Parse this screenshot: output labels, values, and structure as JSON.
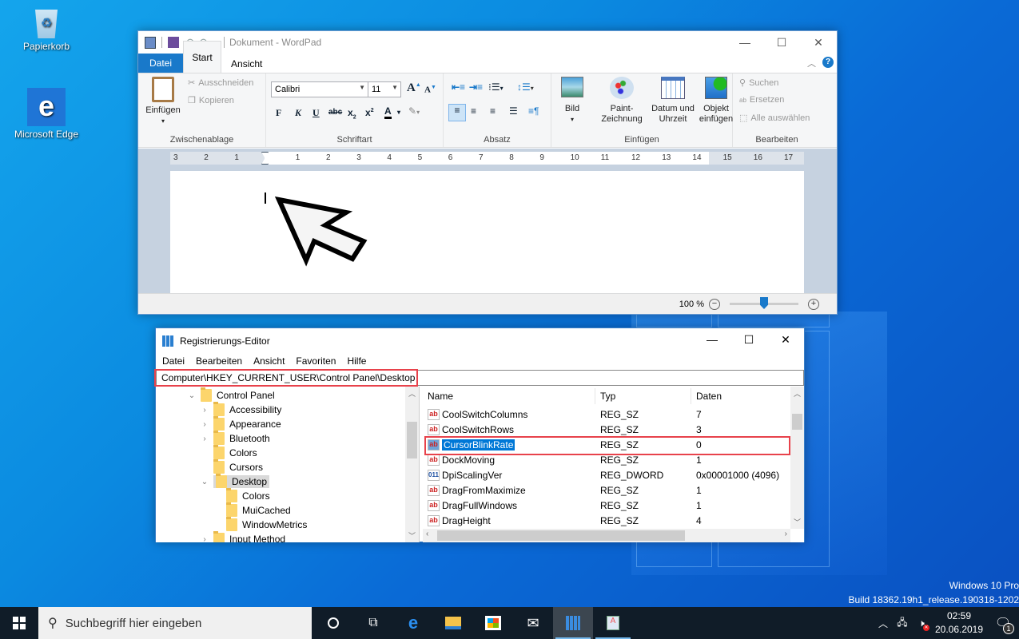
{
  "desktop": {
    "icons": [
      {
        "label": "Papierkorb",
        "icon": "recycle-bin-icon"
      },
      {
        "label": "Microsoft Edge",
        "icon": "edge-icon"
      }
    ],
    "watermark": {
      "line1": "Windows 10 Pro",
      "line2": "Build 18362.19h1_release.190318-1202"
    }
  },
  "wordpad": {
    "title": "Dokument - WordPad",
    "tabs": [
      "Datei",
      "Start",
      "Ansicht"
    ],
    "active_tab": "Start",
    "clipboard": {
      "paste": "Einfügen",
      "cut": "Ausschneiden",
      "copy": "Kopieren",
      "label": "Zwischenablage"
    },
    "font": {
      "family": "Calibri",
      "size": "11",
      "label": "Schriftart",
      "bold": "F",
      "italic": "K",
      "underline": "U",
      "strike": "abc"
    },
    "paragraph": {
      "label": "Absatz"
    },
    "insert": {
      "picture": "Bild",
      "paint": "Paint-",
      "paint2": "Zeichnung",
      "datetime": "Datum und",
      "datetime2": "Uhrzeit",
      "object": "Objekt",
      "object2": "einfügen",
      "label": "Einfügen"
    },
    "edit": {
      "find": "Suchen",
      "replace": "Ersetzen",
      "select_all": "Alle auswählen",
      "label": "Bearbeiten"
    },
    "ruler": [
      "3",
      "2",
      "1",
      "",
      "1",
      "2",
      "3",
      "4",
      "5",
      "6",
      "7",
      "8",
      "9",
      "10",
      "11",
      "12",
      "13",
      "14",
      "15",
      "16",
      "17"
    ],
    "zoom": {
      "label": "100 %",
      "value_percent": 100
    }
  },
  "regedit": {
    "title": "Registrierungs-Editor",
    "menu": [
      "Datei",
      "Bearbeiten",
      "Ansicht",
      "Favoriten",
      "Hilfe"
    ],
    "address": "Computer\\HKEY_CURRENT_USER\\Control Panel\\Desktop",
    "tree": [
      {
        "label": "Control Panel",
        "level": 0,
        "expanded": true
      },
      {
        "label": "Accessibility",
        "level": 1,
        "expandable": true
      },
      {
        "label": "Appearance",
        "level": 1,
        "expandable": true
      },
      {
        "label": "Bluetooth",
        "level": 1,
        "expandable": true
      },
      {
        "label": "Colors",
        "level": 1
      },
      {
        "label": "Cursors",
        "level": 1
      },
      {
        "label": "Desktop",
        "level": 1,
        "expanded": true,
        "selected": true
      },
      {
        "label": "Colors",
        "level": 2
      },
      {
        "label": "MuiCached",
        "level": 2
      },
      {
        "label": "WindowMetrics",
        "level": 2
      },
      {
        "label": "Input Method",
        "level": 1,
        "expandable": true
      }
    ],
    "columns": [
      "Name",
      "Typ",
      "Daten"
    ],
    "values": [
      {
        "name": "CoolSwitchColumns",
        "type": "REG_SZ",
        "data": "7",
        "icon": "ab"
      },
      {
        "name": "CoolSwitchRows",
        "type": "REG_SZ",
        "data": "3",
        "icon": "ab"
      },
      {
        "name": "CursorBlinkRate",
        "type": "REG_SZ",
        "data": "0",
        "icon": "ab",
        "selected": true
      },
      {
        "name": "DockMoving",
        "type": "REG_SZ",
        "data": "1",
        "icon": "ab"
      },
      {
        "name": "DpiScalingVer",
        "type": "REG_DWORD",
        "data": "0x00001000 (4096)",
        "icon": "bin"
      },
      {
        "name": "DragFromMaximize",
        "type": "REG_SZ",
        "data": "1",
        "icon": "ab"
      },
      {
        "name": "DragFullWindows",
        "type": "REG_SZ",
        "data": "1",
        "icon": "ab"
      },
      {
        "name": "DragHeight",
        "type": "REG_SZ",
        "data": "4",
        "icon": "ab"
      }
    ]
  },
  "taskbar": {
    "search_placeholder": "Suchbegriff hier eingeben",
    "apps": [
      "cortana",
      "task-view",
      "edge",
      "file-explorer",
      "store",
      "mail",
      "regedit",
      "wordpad"
    ],
    "time": "02:59",
    "date": "20.06.2019",
    "notification_count": "1"
  },
  "colors": {
    "accent": "#1979ca",
    "highlight": "#e8424b",
    "selection": "#0078d7"
  }
}
